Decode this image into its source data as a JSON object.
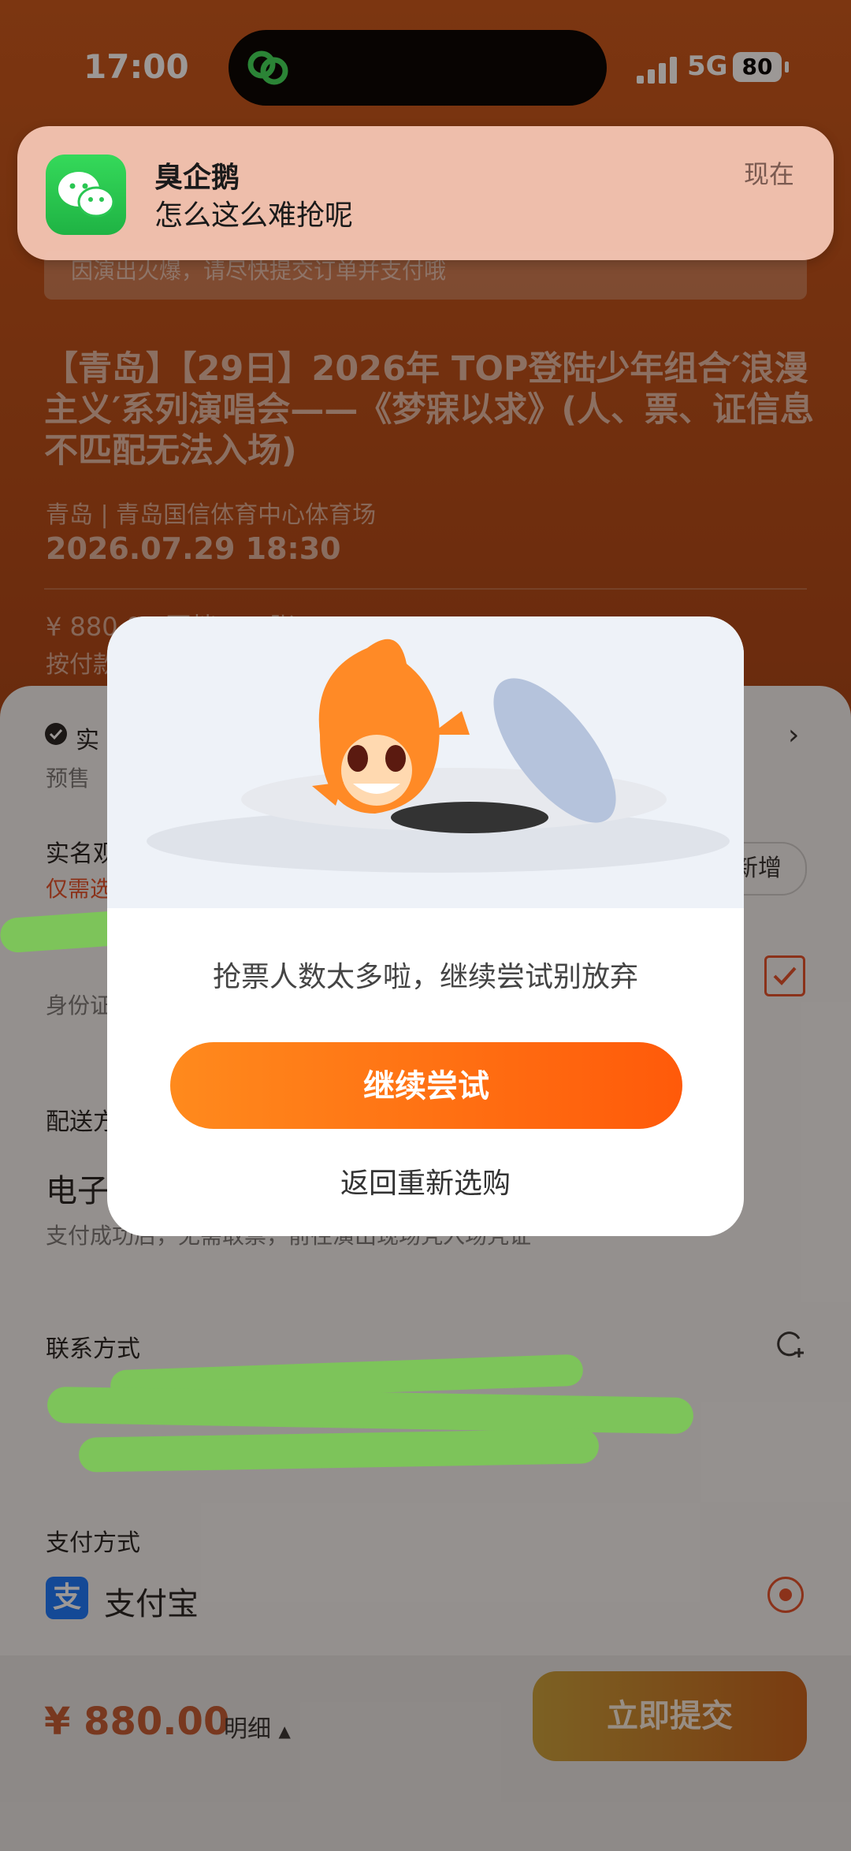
{
  "status_bar": {
    "time": "17:00",
    "network": "5G",
    "battery": "80"
  },
  "notification": {
    "sender": "臭企鹅",
    "message": "怎么这么难抢呢",
    "time": "现在"
  },
  "banner": {
    "text": "因演出火爆，请尽快提交订单并支付哦"
  },
  "event": {
    "title": "【青岛】【29日】2026年 TOP登陆少年组合′浪漫主义′系列演唱会——《梦寐以求》(人、票、证信息不匹配无法入场)",
    "venue": "青岛 | 青岛国信体育中心体育场",
    "datetime": "2026.07.29 18:30",
    "price_line": "¥ 880.00 票档 × 1张",
    "pay_note": "按付款"
  },
  "sheet": {
    "tag_realname": "实",
    "presale": "预售",
    "realname_label": "实名观",
    "realname_hint": "仅需选",
    "add_button": "新增",
    "id_hint": "身份证",
    "delivery_label": "配送方",
    "delivery_value": "电子",
    "delivery_note": "支付成功后，无需取票，前往演出现场凭入场凭证",
    "contact_label": "联系方式",
    "payment_label": "支付方式",
    "payment_value": "支付宝"
  },
  "modal": {
    "message": "抢票人数太多啦，继续尝试别放弃",
    "retry_button": "继续尝试",
    "back_link": "返回重新选购"
  },
  "footer": {
    "total": "¥ 880.00",
    "detail": "明细",
    "submit": "立即提交"
  },
  "colors": {
    "accent": "#ff6a10",
    "background": "#a34512",
    "alipay": "#1677ff"
  }
}
